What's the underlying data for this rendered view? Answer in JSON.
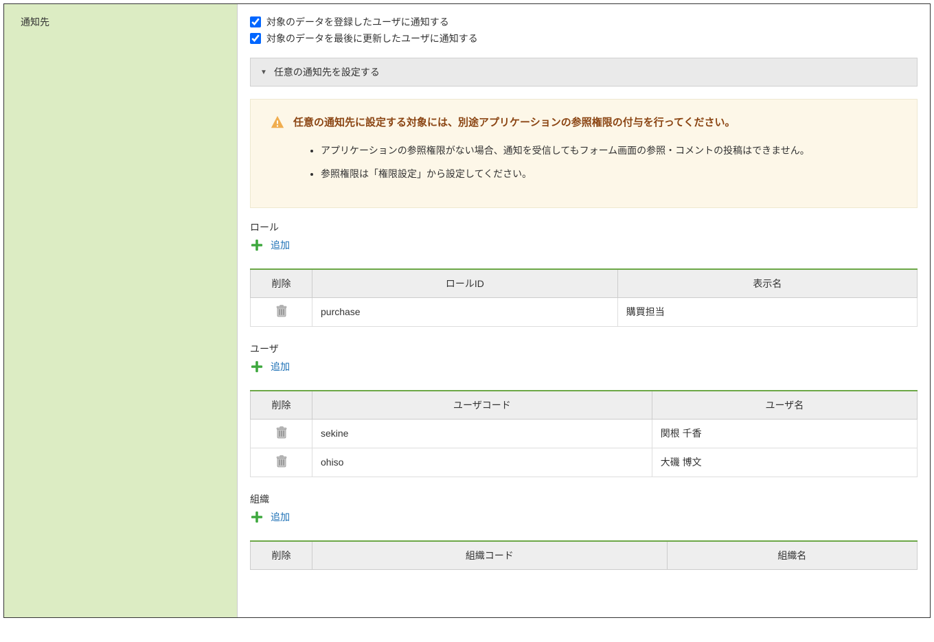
{
  "sidebar": {
    "label": "通知先"
  },
  "checkboxes": {
    "registered_user": "対象のデータを登録したユーザに通知する",
    "updated_user": "対象のデータを最後に更新したユーザに通知する"
  },
  "accordion": {
    "label": "任意の通知先を設定する"
  },
  "warning": {
    "title": "任意の通知先に設定する対象には、別途アプリケーションの参照権限の付与を行ってください。",
    "bullets": [
      "アプリケーションの参照権限がない場合、通知を受信してもフォーム画面の参照・コメントの投稿はできません。",
      "参照権限は「権限設定」から設定してください。"
    ]
  },
  "sections": {
    "role": {
      "label": "ロール",
      "add_label": "追加",
      "table": {
        "headers": {
          "delete": "削除",
          "id": "ロールID",
          "name": "表示名"
        },
        "rows": [
          {
            "id": "purchase",
            "name": "購買担当"
          }
        ]
      }
    },
    "user": {
      "label": "ユーザ",
      "add_label": "追加",
      "table": {
        "headers": {
          "delete": "削除",
          "code": "ユーザコード",
          "name": "ユーザ名"
        },
        "rows": [
          {
            "code": "sekine",
            "name": "関根 千香"
          },
          {
            "code": "ohiso",
            "name": "大磯 博文"
          }
        ]
      }
    },
    "org": {
      "label": "組織",
      "add_label": "追加",
      "table": {
        "headers": {
          "delete": "削除",
          "code": "組織コード",
          "name": "組織名"
        }
      }
    }
  }
}
